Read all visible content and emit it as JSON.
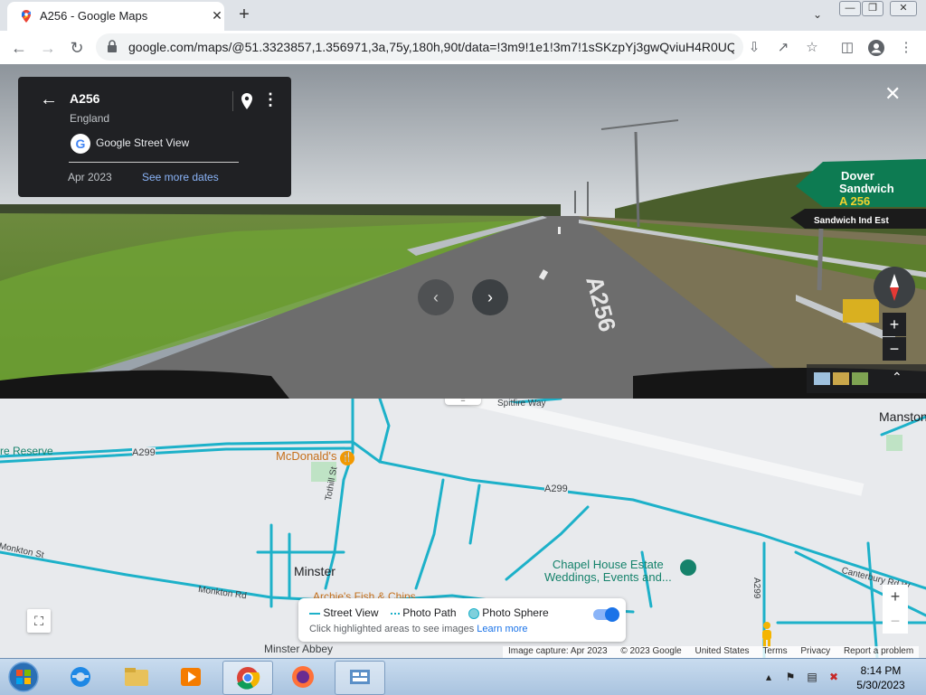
{
  "browser": {
    "tab_title": "A256 - Google Maps",
    "tab_close": "✕",
    "new_tab": "+",
    "url_host": "google.com",
    "url_path": "/maps/@51.3323857,1.356971,3a,75y,180h,90t/data=!3m9!1e1!3m7!1sSKzpYj3gwQviuH4R0UQ..."
  },
  "street_view": {
    "title": "A256",
    "subtitle": "England",
    "source": "Google Street View",
    "date": "Apr 2023",
    "see_more_dates": "See more dates",
    "sign_text": [
      "Dover",
      "Sandwich",
      "A 256",
      "Sandwich Ind Est"
    ]
  },
  "map": {
    "labels": {
      "reserve": "re Reserve",
      "a299_left": "A299",
      "mcdonalds": "McDonald's",
      "a299_center": "A299",
      "spitfire": "Spitfire Way",
      "manston": "Manston",
      "tothill": "Tothill St",
      "monkton_st": "Monkton St",
      "minster": "Minster",
      "monkton_rd": "Monkton Rd",
      "archies": "Archie's Fish & Chips",
      "chapel_1": "Chapel House Estate",
      "chapel_2": "Weddings, Events and...",
      "a299_vertical": "A299",
      "canterbury": "Canterbury Rd W",
      "minster_abbey": "Minster Abbey"
    },
    "legend": {
      "street_view": "Street View",
      "photo_path": "Photo Path",
      "photo_sphere": "Photo Sphere",
      "hint": "Click highlighted areas to see images",
      "learn_more": "Learn more"
    },
    "attribution": [
      "Image capture: Apr 2023",
      "© 2023 Google",
      "United States",
      "Terms",
      "Privacy",
      "Report a problem"
    ]
  },
  "taskbar": {
    "time": "8:14 PM",
    "date": "5/30/2023"
  },
  "colors": {
    "coverage_line": "#1db1c9",
    "map_bg": "#e8eaed",
    "panel_bg": "#202124",
    "link": "#8ab4f8"
  }
}
